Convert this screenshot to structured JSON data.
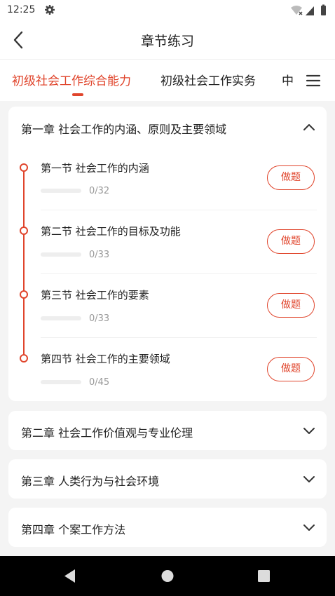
{
  "status_bar": {
    "time": "12:25",
    "settings_icon": "gear-icon",
    "right_icons": [
      "wifi-icon",
      "signal-icon",
      "battery-icon"
    ]
  },
  "header": {
    "title": "章节练习",
    "back_icon": "chevron-left-icon"
  },
  "tabs": [
    {
      "label": "初级社会工作综合能力",
      "active": true
    },
    {
      "label": "初级社会工作实务",
      "active": false
    },
    {
      "label": "中",
      "active": false
    }
  ],
  "menu_icon": "menu-icon",
  "colors": {
    "accent": "#e0452c",
    "background": "#f4f4f4",
    "card": "#ffffff",
    "muted_text": "#999999"
  },
  "chapters": [
    {
      "title": "第一章 社会工作的内涵、原则及主要领域",
      "expanded": true,
      "sections": [
        {
          "title": "第一节 社会工作的内涵",
          "progress": "0/32",
          "button": "做题"
        },
        {
          "title": "第二节 社会工作的目标及功能",
          "progress": "0/33",
          "button": "做题"
        },
        {
          "title": "第三节 社会工作的要素",
          "progress": "0/33",
          "button": "做题"
        },
        {
          "title": "第四节 社会工作的主要领域",
          "progress": "0/45",
          "button": "做题"
        }
      ]
    },
    {
      "title": "第二章 社会工作价值观与专业伦理",
      "expanded": false
    },
    {
      "title": "第三章 人类行为与社会环境",
      "expanded": false
    },
    {
      "title": "第四章 个案工作方法",
      "expanded": false
    }
  ],
  "system_nav": [
    "back-triangle-icon",
    "home-circle-icon",
    "recents-square-icon"
  ]
}
